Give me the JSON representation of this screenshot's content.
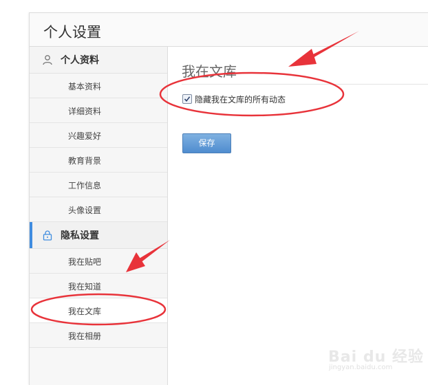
{
  "header": {
    "title": "个人设置"
  },
  "sidebar": {
    "personal": {
      "label": "个人资料",
      "icon": "user-icon",
      "items": [
        {
          "label": "基本资料"
        },
        {
          "label": "详细资料"
        },
        {
          "label": "兴趣爱好"
        },
        {
          "label": "教育背景"
        },
        {
          "label": "工作信息"
        },
        {
          "label": "头像设置"
        }
      ]
    },
    "privacy": {
      "label": "隐私设置",
      "icon": "lock-icon",
      "items": [
        {
          "label": "我在贴吧"
        },
        {
          "label": "我在知道"
        },
        {
          "label": "我在文库"
        },
        {
          "label": "我在相册"
        }
      ],
      "selected_item": "我在文库"
    }
  },
  "main": {
    "title": "我在文库",
    "checkbox_label": "隐藏我在文库的所有动态",
    "checkbox_checked": true,
    "save_label": "保存"
  },
  "watermark": {
    "logo": "Bai du 经验",
    "url": "jingyan.baidu.com"
  },
  "colors": {
    "accent": "#3f8ce0",
    "button": "#5b97d6",
    "annotation": "#e8333a"
  }
}
